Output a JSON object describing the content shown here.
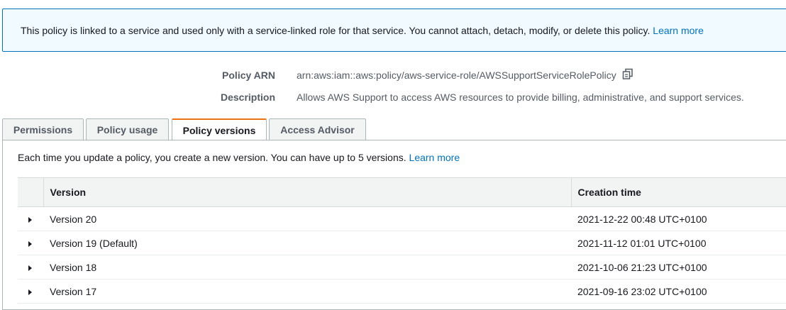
{
  "banner": {
    "text": "This policy is linked to a service and used only with a service-linked role for that service. You cannot attach, detach, modify, or delete this policy.",
    "link": "Learn more"
  },
  "summary": {
    "arn_label": "Policy ARN",
    "arn_value": "arn:aws:iam::aws:policy/aws-service-role/AWSSupportServiceRolePolicy",
    "description_label": "Description",
    "description_value": "Allows AWS Support to access AWS resources to provide billing, administrative, and support services."
  },
  "tabs": [
    {
      "label": "Permissions",
      "active": false
    },
    {
      "label": "Policy usage",
      "active": false
    },
    {
      "label": "Policy versions",
      "active": true
    },
    {
      "label": "Access Advisor",
      "active": false
    }
  ],
  "versions_panel": {
    "intro": "Each time you update a policy, you create a new version. You can have up to 5 versions.",
    "intro_link": "Learn more",
    "columns": [
      "Version",
      "Creation time"
    ],
    "rows": [
      {
        "version": "Version 20",
        "created": "2021-12-22 00:48 UTC+0100"
      },
      {
        "version": "Version 19 (Default)",
        "created": "2021-11-12 01:01 UTC+0100"
      },
      {
        "version": "Version 18",
        "created": "2021-10-06 21:23 UTC+0100"
      },
      {
        "version": "Version 17",
        "created": "2021-09-16 23:02 UTC+0100"
      }
    ]
  },
  "icons": {
    "copy": "copy-icon",
    "expand": "caret-right-icon"
  },
  "colors": {
    "link": "#0073bb",
    "banner_border": "#0073bb",
    "banner_bg": "#f1faff",
    "active_tab_accent": "#ec7211"
  }
}
